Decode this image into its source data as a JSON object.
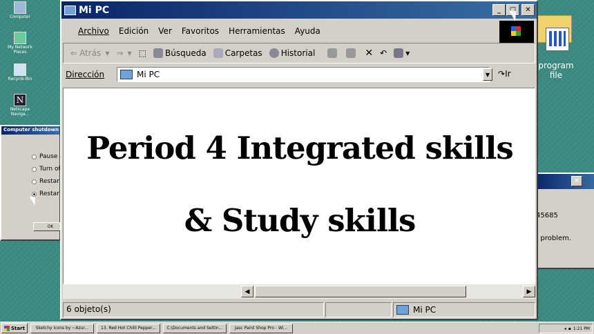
{
  "desktop": {
    "icons": [
      {
        "label": "Computer",
        "icon": "computer-icon"
      },
      {
        "label": "My Network Places",
        "icon": "network-icon"
      },
      {
        "label": "Recycle Bin",
        "icon": "recycle-bin-icon"
      },
      {
        "label": "Netscape Naviga...",
        "icon": "netscape-icon"
      }
    ],
    "program_file_label": "program file",
    "colors": {
      "background": "#3a8a80"
    }
  },
  "shutdown_dialog": {
    "title": "Computer shutdown",
    "options": [
      "Pause",
      "Turn of",
      "Restar",
      "Restar"
    ],
    "ok_label": "OK"
  },
  "right_window": {
    "text1": "45685",
    "text2": ": problem."
  },
  "explorer": {
    "title": "Mi PC",
    "menu": [
      "Archivo",
      "Edición",
      "Ver",
      "Favoritos",
      "Herramientas",
      "Ayuda"
    ],
    "toolbar": {
      "back": "Atrás",
      "search": "Búsqueda",
      "folders": "Carpetas",
      "history": "Historial"
    },
    "address_label": "Dirección",
    "address_value": "Mi PC",
    "go_label": "Ir",
    "content": {
      "line1": "Period 4 Integrated skills",
      "line2": "& Study skills"
    },
    "status_objects": "6 objeto(s)",
    "status_location": "Mi PC"
  },
  "taskbar": {
    "start": "Start",
    "tasks": [
      "Sketchy Icons by ~Azur...",
      "13. Red Hot Chilli Pepper...",
      "C:\\Documents and Settin...",
      "Jasc Paint Shop Pro - Wi..."
    ],
    "clock": "1:21 PM"
  }
}
